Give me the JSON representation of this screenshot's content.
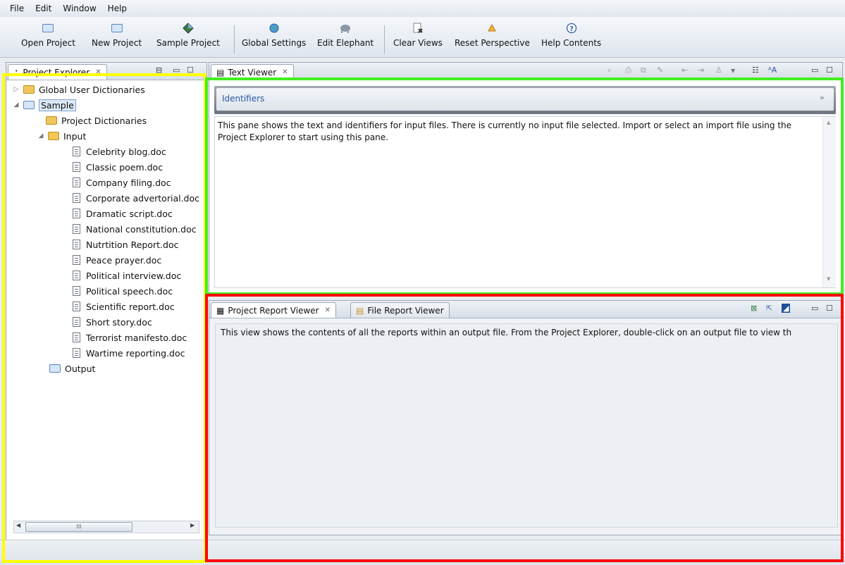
{
  "menu": [
    "File",
    "Edit",
    "Window",
    "Help"
  ],
  "toolbar": {
    "open_project": "Open Project",
    "new_project": "New Project",
    "sample_project": "Sample Project",
    "global_settings": "Global Settings",
    "edit_elephant": "Edit Elephant",
    "clear_views": "Clear Views",
    "reset_perspective": "Reset Perspective",
    "help_contents": "Help Contents"
  },
  "explorer": {
    "tab_label": "Project Explorer",
    "items": {
      "global_dicts": "Global User Dictionaries",
      "sample": "Sample",
      "project_dicts": "Project Dictionaries",
      "input": "Input",
      "output": "Output"
    },
    "files": [
      "Celebrity blog.doc",
      "Classic poem.doc",
      "Company filing.doc",
      "Corporate advertorial.doc",
      "Dramatic script.doc",
      "National constitution.doc",
      "Nutrtition Report.doc",
      "Peace prayer.doc",
      "Political interview.doc",
      "Political speech.doc",
      "Scientific report.doc",
      "Short story.doc",
      "Terrorist manifesto.doc",
      "Wartime reporting.doc"
    ],
    "scroll_thumb": "III"
  },
  "text_viewer": {
    "tab_label": "Text Viewer",
    "section_title": "Identifiers",
    "body": "This pane shows the text and identifiers for input files. There is currently no input file selected. Import or select an import file using the Project Explorer to start using this pane."
  },
  "report_viewer": {
    "tab_project": "Project Report Viewer",
    "tab_file": "File Report Viewer",
    "body": "This view shows the contents of all the reports within an output file.  From the Project Explorer, double-click on an output file to view th"
  },
  "colors": {
    "highlight_explorer": "#ffff00",
    "highlight_text_viewer": "#44ee22",
    "highlight_report_viewer": "#ff0000"
  }
}
